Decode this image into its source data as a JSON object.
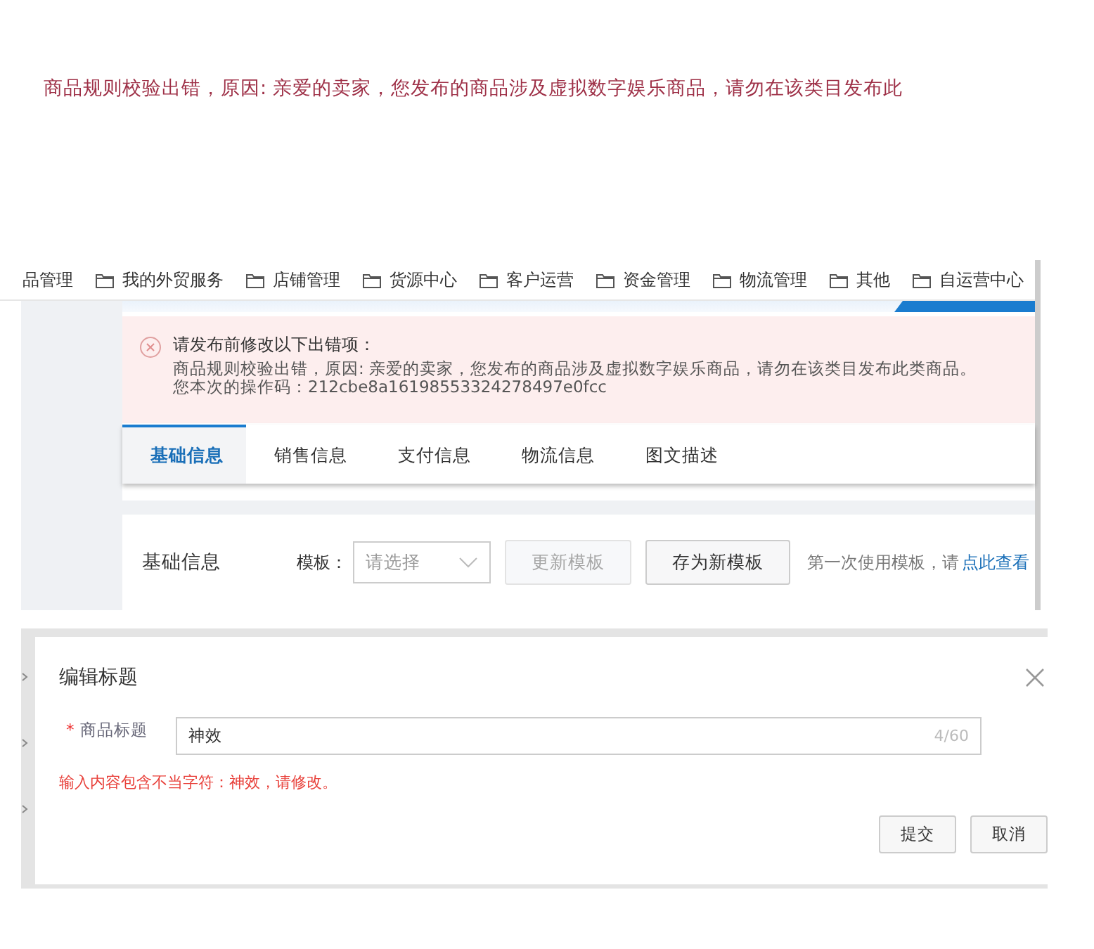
{
  "banner_error": "商品规则校验出错，原因: 亲爱的卖家，您发布的商品涉及虚拟数字娱乐商品，请勿在该类目发布此",
  "nav": {
    "items": [
      {
        "label": "品管理",
        "icon": false
      },
      {
        "label": "我的外贸服务",
        "icon": true
      },
      {
        "label": "店铺管理",
        "icon": true
      },
      {
        "label": "货源中心",
        "icon": true
      },
      {
        "label": "客户运营",
        "icon": true
      },
      {
        "label": "资金管理",
        "icon": true
      },
      {
        "label": "物流管理",
        "icon": true
      },
      {
        "label": "其他",
        "icon": true
      },
      {
        "label": "自运营中心",
        "icon": true
      }
    ]
  },
  "error_box": {
    "title": "请发布前修改以下出错项：",
    "lines": [
      "商品规则校验出错，原因: 亲爱的卖家，您发布的商品涉及虚拟数字娱乐商品，请勿在该类目发布此类商品。",
      "您本次的操作码：212cbe8a16198553324278497e0fcc"
    ]
  },
  "tabs": [
    {
      "label": "基础信息",
      "selected": true
    },
    {
      "label": "销售信息",
      "selected": false
    },
    {
      "label": "支付信息",
      "selected": false
    },
    {
      "label": "物流信息",
      "selected": false
    },
    {
      "label": "图文描述",
      "selected": false
    }
  ],
  "section": {
    "title": "基础信息",
    "template_label": "模板：",
    "select_placeholder": "请选择",
    "buttons": [
      {
        "label": "更新模板",
        "disabled": true
      },
      {
        "label": "存为新模板",
        "disabled": false
      }
    ],
    "hint": "第一次使用模板，请",
    "hint_link": "点此查看"
  },
  "dialog": {
    "title": "编辑标题",
    "required_mark": "*",
    "field_label": "商品标题",
    "value": "神效",
    "counter": "4/60",
    "error": "输入内容包含不当字符：神效，请修改。",
    "buttons": [
      "提交",
      "取消"
    ]
  }
}
